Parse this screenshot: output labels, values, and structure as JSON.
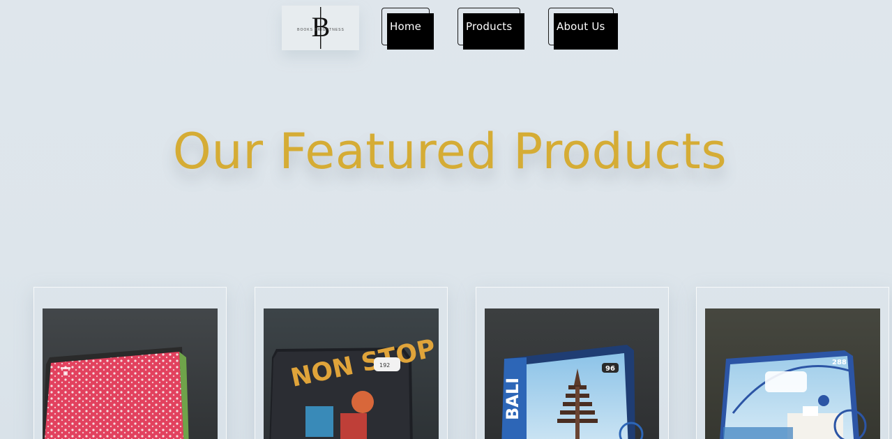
{
  "nav": {
    "logo_text": "BOOKS BRIGHTNESS",
    "logo_monogram": "B|B",
    "items": [
      {
        "label": "Home"
      },
      {
        "label": "Products"
      },
      {
        "label": "About Us"
      }
    ]
  },
  "hero": {
    "title": "Our Featured Products"
  },
  "products": [
    {
      "image": "notebook-pink-floral"
    },
    {
      "image": "notebook-non-stop",
      "cover_text": "NON STOP",
      "badge": "192"
    },
    {
      "image": "notebook-bali",
      "cover_text": "BALI",
      "badge": "96"
    },
    {
      "image": "notebook-santorini",
      "badge": "288"
    }
  ],
  "colors": {
    "background": "#dde5eb",
    "title": "#d5ac35",
    "nav_button": "#000000",
    "nav_text": "#ffffff",
    "card_border": "#f7f9fa"
  }
}
